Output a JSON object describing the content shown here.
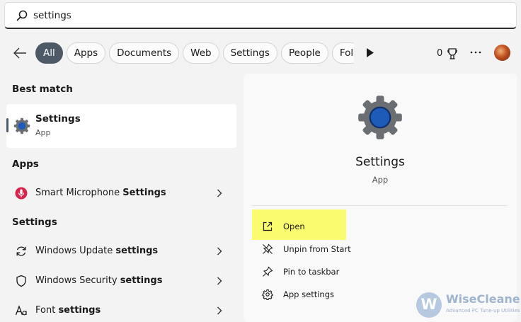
{
  "search": {
    "value": "settings"
  },
  "filters": {
    "chips": [
      "All",
      "Apps",
      "Documents",
      "Web",
      "Settings",
      "People",
      "Folde"
    ],
    "rewards_count": "0"
  },
  "left": {
    "best_match_heading": "Best match",
    "best_match": {
      "title": "Settings",
      "subtitle": "App"
    },
    "apps_heading": "Apps",
    "apps_item": {
      "prefix": "Smart Microphone ",
      "bold": "Settings"
    },
    "settings_heading": "Settings",
    "settings_items": [
      {
        "prefix": "Windows Update ",
        "bold": "settings",
        "icon": "refresh-icon"
      },
      {
        "prefix": "Windows Security ",
        "bold": "settings",
        "icon": "shield-icon"
      },
      {
        "prefix": "Font ",
        "bold": "settings",
        "icon": "font-icon"
      }
    ]
  },
  "right": {
    "title": "Settings",
    "subtitle": "App",
    "actions": [
      {
        "label": "Open",
        "icon": "open-external-icon"
      },
      {
        "label": "Unpin from Start",
        "icon": "unpin-icon"
      },
      {
        "label": "Pin to taskbar",
        "icon": "pin-icon"
      },
      {
        "label": "App settings",
        "icon": "gear-icon"
      }
    ]
  },
  "watermark": {
    "brand": "WiseCleaner",
    "tagline": "Advanced PC Tune-up Utilities",
    "logo_letter": "W"
  },
  "colors": {
    "accent": "#4d5966",
    "highlight": "#fbfb70",
    "gear_blue": "#1e5bb8",
    "gear_gray": "#6b6f74"
  }
}
